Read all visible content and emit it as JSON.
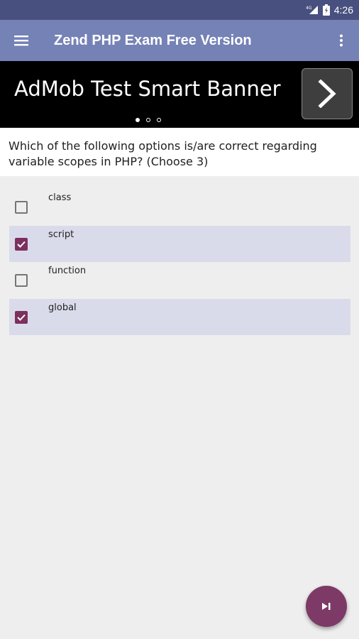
{
  "status_bar": {
    "network": "4G",
    "time": "4:26"
  },
  "app_bar": {
    "title": "Zend PHP Exam Free Version",
    "menu_icon": "hamburger-menu-icon",
    "overflow_icon": "more-vert-icon"
  },
  "banner": {
    "text": "AdMob Test Smart Banner",
    "arrow_icon": "chevron-right-icon",
    "dots": 3,
    "active_dot": 1
  },
  "question": {
    "text": "Which of the following options is/are correct regarding variable scopes in PHP? (Choose 3)"
  },
  "options": [
    {
      "label": "class",
      "checked": false
    },
    {
      "label": "script",
      "checked": true
    },
    {
      "label": "function",
      "checked": false
    },
    {
      "label": "global",
      "checked": true
    }
  ],
  "fab": {
    "icon": "skip-next-icon"
  },
  "colors": {
    "status_bar": "#47507e",
    "app_bar": "#7582b6",
    "accent": "#7d2f5e",
    "selected_row": "#dadbea"
  }
}
